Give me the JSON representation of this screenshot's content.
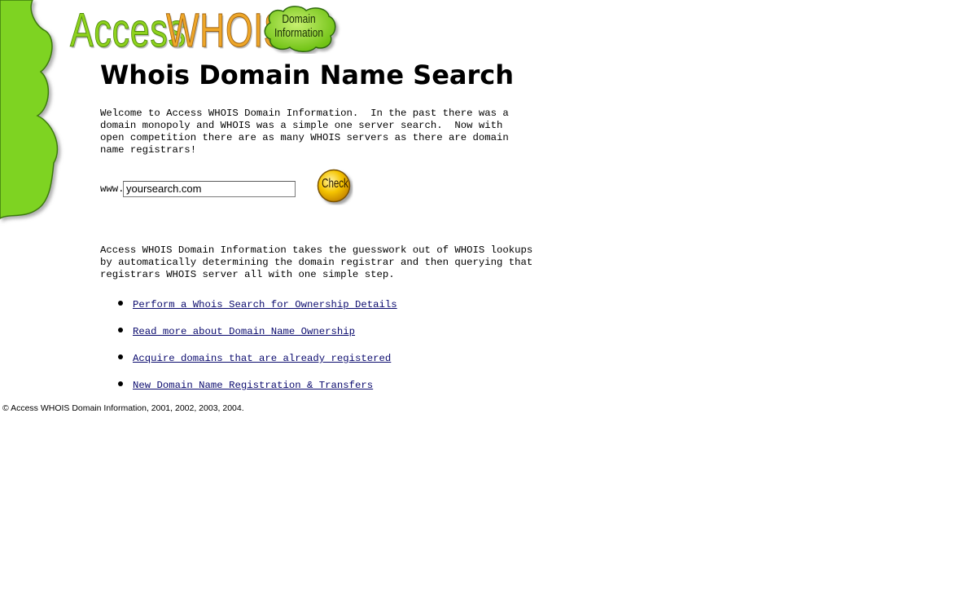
{
  "logo": {
    "word_access": "Access",
    "word_whois": "WHOIS",
    "badge_line1": "Domain",
    "badge_line2": "Information"
  },
  "page": {
    "title": "Whois Domain Name Search",
    "intro": "Welcome to Access WHOIS Domain Information.  In the past there was a\ndomain monopoly and WHOIS was a simple one server search.  Now with\nopen competition there are as many WHOIS servers as there are domain\nname registrars!",
    "description": "Access WHOIS Domain Information takes the guesswork out of WHOIS lookups\nby automatically determining the domain registrar and then querying that\nregistrars WHOIS server all with one simple step."
  },
  "search": {
    "prefix": "www.",
    "value": "yoursearch.com",
    "button_label": "Check"
  },
  "links": [
    "Perform a Whois Search for Ownership Details",
    "Read more about Domain Name Ownership",
    "Acquire domains that are already registered",
    "New Domain Name Registration & Transfers"
  ],
  "footer": {
    "copyright": "© Access WHOIS Domain Information, 2001, 2002, 2003, 2004."
  },
  "colors": {
    "cloud_green": "#7ed321",
    "access_green": "#8ed21d",
    "whois_orange": "#eea629",
    "check_yellow": "#f5c400",
    "link_blue": "#0a0a6e"
  }
}
